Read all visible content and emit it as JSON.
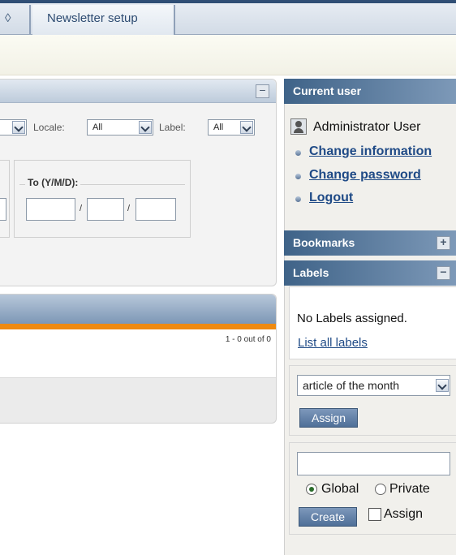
{
  "tabs": {
    "partial_label": "◊",
    "newsletter_label": "Newsletter setup"
  },
  "filter": {
    "locale_label": "Locale:",
    "locale_value": "All",
    "label_label": "Label:",
    "label_value": "All",
    "to_legend": "To (Y/M/D):",
    "slash": "/"
  },
  "results": {
    "count": "1 - 0 out of 0"
  },
  "sidebar": {
    "current_user_title": "Current user",
    "user_name": "Administrator User",
    "links": [
      "Change information",
      "Change password",
      "Logout"
    ],
    "bookmarks_title": "Bookmarks",
    "labels_title": "Labels",
    "no_labels": "No Labels assigned.",
    "list_all": "List all labels",
    "label_select": "article of the month",
    "assign_button": "Assign",
    "global_label": "Global",
    "private_label": "Private",
    "create_button": "Create",
    "assign_check_label": "Assign"
  },
  "icons": {
    "collapse": "minus-icon",
    "expand": "plus-icon",
    "user": "user-icon",
    "dropdown": "chevron-down-icon"
  }
}
